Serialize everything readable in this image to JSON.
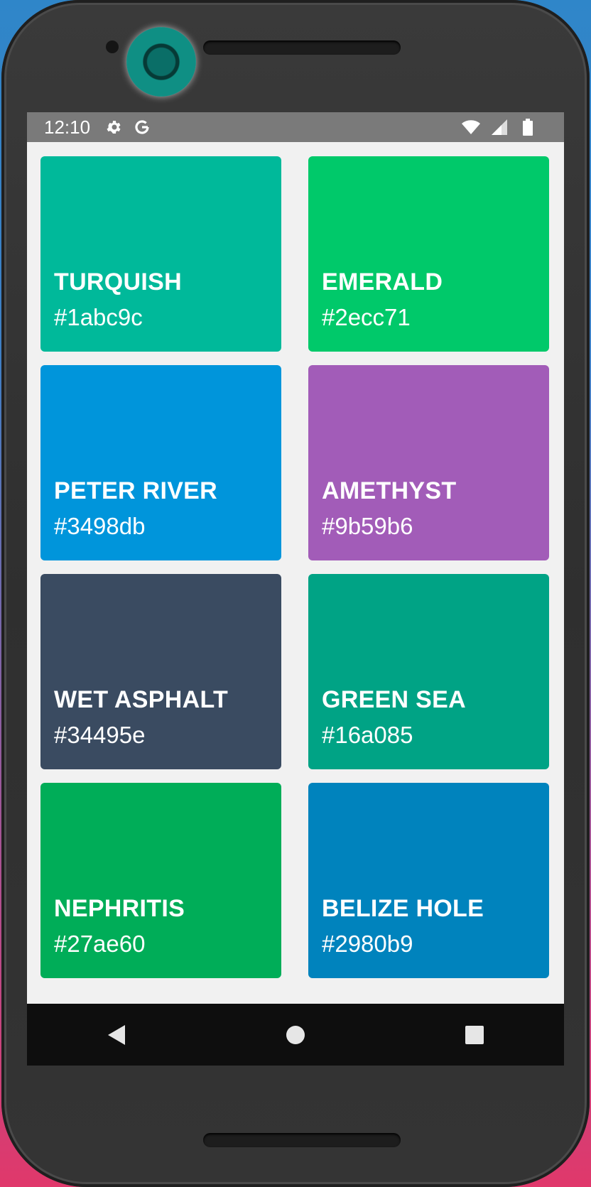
{
  "status_bar": {
    "time": "12:10",
    "icons": [
      "settings-icon",
      "google-icon",
      "wifi-icon",
      "signal-icon",
      "battery-icon"
    ]
  },
  "colors": [
    {
      "name": "TURQUISH",
      "hex": "#1abc9c"
    },
    {
      "name": "EMERALD",
      "hex": "#2ecc71"
    },
    {
      "name": "PETER RIVER",
      "hex": "#3498db"
    },
    {
      "name": "AMETHYST",
      "hex": "#9b59b6"
    },
    {
      "name": "WET ASPHALT",
      "hex": "#34495e"
    },
    {
      "name": "GREEN SEA",
      "hex": "#16a085"
    },
    {
      "name": "NEPHRITIS",
      "hex": "#27ae60"
    },
    {
      "name": "BELIZE HOLE",
      "hex": "#2980b9"
    }
  ],
  "nav_bar": {
    "icons": [
      "back-icon",
      "home-icon",
      "recents-icon"
    ]
  }
}
